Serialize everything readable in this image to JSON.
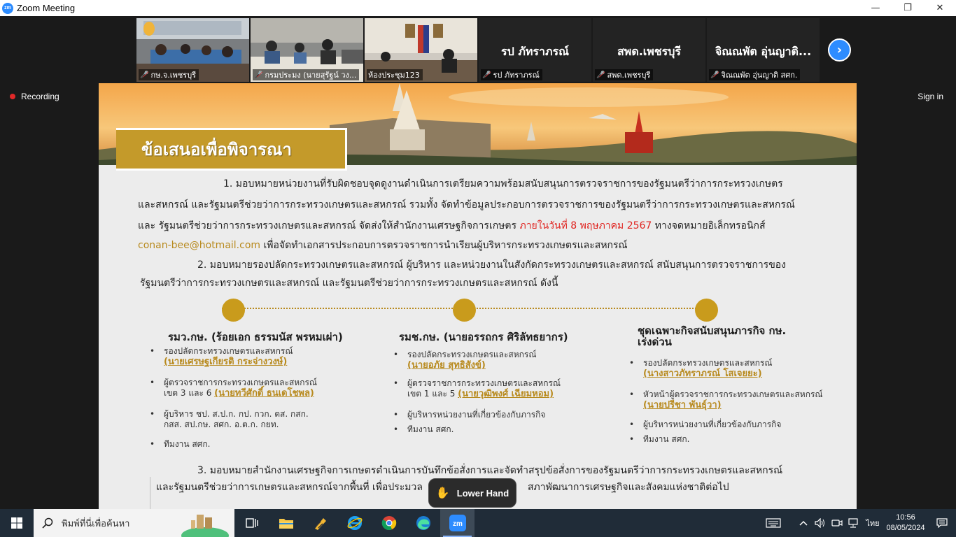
{
  "window": {
    "title": "Zoom Meeting",
    "app_icon": "zm",
    "minimize": "—",
    "restore": "❐",
    "close": "✕"
  },
  "thumbnails": [
    {
      "label": "กษ.จ.เพชรบุรี",
      "video": true
    },
    {
      "label": "กรมประมง (นายสุรัฐน์ วง...",
      "video": true
    },
    {
      "label": "ห้องประชุม123",
      "video": true,
      "active": true
    },
    {
      "label": "รป ภัทราภรณ์",
      "big_name": "รป ภัทราภรณ์",
      "video": false
    },
    {
      "label": "สพด.เพชรบุรี",
      "big_name": "สพด.เพชรบุรี",
      "video": false
    },
    {
      "label": "จิณณพัต อุ่นญาติ สศก.",
      "big_name": "จิณณพัต อุ่นญาติ...",
      "video": false
    }
  ],
  "recording_label": "Recording",
  "sign_in_label": "Sign in",
  "slide": {
    "heading": "ข้อเสนอเพื่อพิจารณา",
    "p1_line1": "1. มอบหมายหน่วยงานที่รับผิดชอบจุดดูงานดำเนินการเตรียมความพร้อมสนับสนุนการตรวจราชการของรัฐมนตรีว่าการกระทรวงเกษตร",
    "p1_line2": "และสหกรณ์ และรัฐมนตรีช่วยว่าการกระทรวงเกษตรและสหกรณ์ รวมทั้ง จัดทำข้อมูลประกอบการตรวจราชการของรัฐมนตรีว่าการกระทรวงเกษตรและสหกรณ์",
    "p1_line3a": "และ รัฐมนตรีช่วยว่าการกระทรวงเกษตรและสหกรณ์ จัดส่งให้สำนักงานเศรษฐกิจการเกษตร ",
    "p1_line3_deadline": "ภายในวันที่ 8 พฤษภาคม 2567",
    "p1_line3b": " ทางจดหมายอิเล็กทรอนิกส์",
    "p1_email": "conan-bee@hotmail.com",
    "p1_line4b": " เพื่อจัดทำเอกสารประกอบการตรวจราชการนำเรียนผู้บริหารกระทรวงเกษตรและสหกรณ์",
    "p2_line1": "2. มอบหมายรองปลัดกระทรวงเกษตรและสหกรณ์ ผู้บริหาร และหน่วยงานในสังกัดกระทรวงเกษตรและสหกรณ์ สนับสนุนการตรวจราชการของ",
    "p2_line2": "รัฐมนตรีว่าการกระทรวงเกษตรและสหกรณ์ และรัฐมนตรีช่วยว่าการกระทรวงเกษตรและสหกรณ์ ดังนี้",
    "columns": [
      {
        "title": "รมว.กษ. (ร้อยเอก ธรรมนัส พรหมเผ่า)",
        "items": [
          {
            "text": "รองปลัดกระทรวงเกษตรและสหกรณ์",
            "highlight": "(นายเศรษฐเกียรติ กระจ่างวงษ์)"
          },
          {
            "text": "ผู้ตรวจราชการกระทรวงเกษตรและสหกรณ์",
            "text2": "เขต 3 และ 6 ",
            "highlight": "(นายทวีศักดิ์ ธนเดโชพล)"
          },
          {
            "text": "ผู้บริหาร ชป. ส.ป.ก. กป. กวก. ตส. กสก.",
            "text2": "กสส. สป.กษ. สศก. อ.ต.ก. กยท."
          },
          {
            "text": "ทีมงาน สศก."
          }
        ]
      },
      {
        "title": "รมช.กษ. (นายอรรถกร ศิริลัทธยากร)",
        "items": [
          {
            "text": "รองปลัดกระทรวงเกษตรและสหกรณ์",
            "highlight": "(นายอภัย สุทธิสังข์)"
          },
          {
            "text": "ผู้ตรวจราชการกระทรวงเกษตรและสหกรณ์",
            "text2": "เขต 1 และ 5 ",
            "highlight": "(นายวุฒิพงศ์ เฉียมหอม)"
          },
          {
            "text": "ผู้บริหารหน่วยงานที่เกี่ยวข้องกับภารกิจ"
          },
          {
            "text": "ทีมงาน สศก."
          }
        ]
      },
      {
        "title": "ชุดเฉพาะกิจสนับสนุนภารกิจ กษ.",
        "title2": "เร่งด่วน",
        "items": [
          {
            "text": "รองปลัดกระทรวงเกษตรและสหกรณ์",
            "highlight": "(นางสาวภัทราภรณ์ โสเจยยะ)"
          },
          {
            "text": "หัวหน้าผู้ตรวจราชการกระทรวงเกษตรและสหกรณ์",
            "highlight": "(นายปรีชา พันธุ์วา)"
          },
          {
            "text": "ผู้บริหารหน่วยงานที่เกี่ยวข้องกับภารกิจ"
          },
          {
            "text": "ทีมงาน สศก."
          }
        ]
      }
    ],
    "p3_line1": "3. มอบหมายสำนักงานเศรษฐกิจการเกษตรดำเนินการบันทึกข้อสั่งการและจัดทำสรุปข้อสั่งการของรัฐมนตรีว่าการกระทรวงเกษตรและสหกรณ์",
    "p3_line2a": "และรัฐมนตรีช่วยว่าการเกษตรและสหกรณ์จากพื้นที่ เพื่อประมวล",
    "p3_line2b": "สภาพัฒนาการเศรษฐกิจและสังคมแห่งชาติต่อไป"
  },
  "lower_hand_label": "Lower Hand",
  "taskbar": {
    "search_placeholder": "พิมพ์ที่นี่เพื่อค้นหา",
    "apps": [
      "task-view",
      "file-explorer",
      "app-tool",
      "internet-explorer",
      "chrome",
      "edge",
      "zoom"
    ],
    "language": "ไทย",
    "time": "10:56",
    "date": "08/05/2024"
  },
  "colors": {
    "accent_blue": "#2d8cff",
    "gold": "#c49a2a",
    "deadline_red": "#e0231f",
    "recording_red": "#e02828"
  }
}
